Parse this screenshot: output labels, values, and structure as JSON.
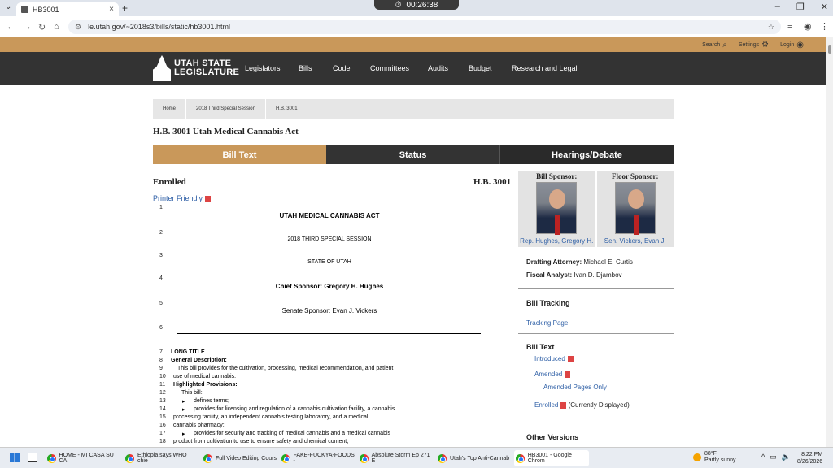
{
  "browser": {
    "tab_title": "HB3001",
    "timer": "00:26:38",
    "url": "le.utah.gov/~2018s3/bills/static/hb3001.html"
  },
  "site": {
    "top_links": {
      "search": "Search",
      "settings": "Settings",
      "login": "Login"
    },
    "logo": {
      "line1": "UTAH STATE",
      "line2": "LEGISLATURE"
    },
    "nav": [
      "Legislators",
      "Bills",
      "Code",
      "Committees",
      "Audits",
      "Budget",
      "Research and Legal"
    ]
  },
  "breadcrumb": [
    "Home",
    "2018 Third Special Session",
    "H.B. 3001"
  ],
  "bill_title": "H.B. 3001 Utah Medical Cannabis Act",
  "tabs": [
    "Bill Text",
    "Status",
    "Hearings/Debate"
  ],
  "bill": {
    "enrolled": "Enrolled",
    "number": "H.B. 3001",
    "printer_friendly": "Printer Friendly",
    "header_lines": [
      {
        "n": "1",
        "text": "UTAH MEDICAL CANNABIS ACT"
      },
      {
        "n": "2",
        "text": "2018 THIRD SPECIAL SESSION"
      },
      {
        "n": "3",
        "text": "STATE OF UTAH"
      },
      {
        "n": "4",
        "text": "Chief Sponsor: Gregory H. Hughes"
      },
      {
        "n": "5",
        "text": "Senate Sponsor: Evan J. Vickers"
      },
      {
        "n": "6",
        "text": ""
      }
    ],
    "body_lines": [
      {
        "n": "7",
        "text": "LONG TITLE"
      },
      {
        "n": "8",
        "text": "General Description:"
      },
      {
        "n": "9",
        "text": "This bill provides for the cultivation, processing, medical recommendation, and patient"
      },
      {
        "n": "10",
        "text": "use of medical cannabis."
      },
      {
        "n": "11",
        "text": "Highlighted Provisions:"
      },
      {
        "n": "12",
        "text": "This bill:"
      },
      {
        "n": "13",
        "text": "defines terms;"
      },
      {
        "n": "14",
        "text": "provides for licensing and regulation of a cannabis cultivation facility, a cannabis"
      },
      {
        "n": "15",
        "text": "processing facility, an independent cannabis testing laboratory, and a medical"
      },
      {
        "n": "16",
        "text": "cannabis pharmacy;"
      },
      {
        "n": "17",
        "text": "provides for security and tracking of medical cannabis and a medical cannabis"
      },
      {
        "n": "18",
        "text": "product from cultivation to use to ensure safety and chemical content;"
      }
    ]
  },
  "sidebar": {
    "bill_sponsor_label": "Bill Sponsor:",
    "floor_sponsor_label": "Floor Sponsor:",
    "bill_sponsor": "Rep. Hughes, Gregory H.",
    "floor_sponsor": "Sen. Vickers, Evan J.",
    "drafting_attorney_label": "Drafting Attorney:",
    "drafting_attorney": "Michael E. Curtis",
    "fiscal_analyst_label": "Fiscal Analyst:",
    "fiscal_analyst": "Ivan D. Djambov",
    "bill_tracking": "Bill Tracking",
    "tracking_page": "Tracking Page",
    "bill_text": "Bill Text",
    "introduced": "Introduced",
    "amended": "Amended",
    "amended_pages_only": "Amended Pages Only",
    "enrolled": "Enrolled",
    "currently_displayed": "(Currently Displayed)",
    "other_versions": "Other Versions"
  },
  "taskbar": {
    "apps": [
      "HOME - MI CASA SU CA",
      "Ethiopia says WHO chie",
      "Full Video Editing Cours",
      "FAKE-FUCKYA-FOODS -",
      "Absolute Storm Ep 271 E",
      "Utah's Top Anti-Cannab",
      "HB3001 - Google Chrom"
    ],
    "weather_temp": "88°F",
    "weather_desc": "Partly sunny",
    "time": "8:22 PM",
    "date": "8/26/2026"
  }
}
